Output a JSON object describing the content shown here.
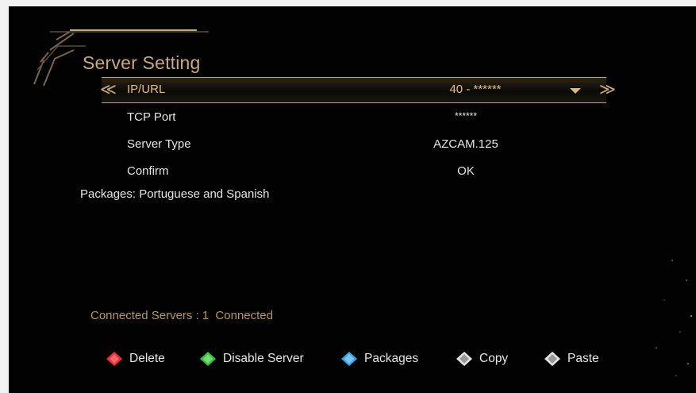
{
  "title": "Server Setting",
  "rows": [
    {
      "label": "IP/URL",
      "value": "40 - ******"
    },
    {
      "label": "TCP Port",
      "value": "******"
    },
    {
      "label": "Server Type",
      "value": "AZCAM.125"
    },
    {
      "label": "Confirm",
      "value": "OK"
    }
  ],
  "nav": {
    "prev": "≪",
    "next": "≫"
  },
  "packages_text": "Packages: Portuguese and Spanish",
  "status": {
    "label": "Connected Servers : 1",
    "state": "Connected"
  },
  "legend": [
    {
      "label": "Delete",
      "color": "#e8303a",
      "icon": "red-button-icon"
    },
    {
      "label": "Disable Server",
      "color": "#36c23a",
      "icon": "green-button-icon"
    },
    {
      "label": "Packages",
      "color": "#3aa6e8",
      "icon": "blue-button-icon"
    },
    {
      "label": "Copy",
      "color": "#e6e6e6",
      "icon": "white-button-icon"
    },
    {
      "label": "Paste",
      "color": "#e6e6e6",
      "icon": "white-button-icon"
    }
  ],
  "colors": {
    "accent": "#c9aa7d",
    "background": "#010101",
    "text": "#e6e6e6"
  }
}
